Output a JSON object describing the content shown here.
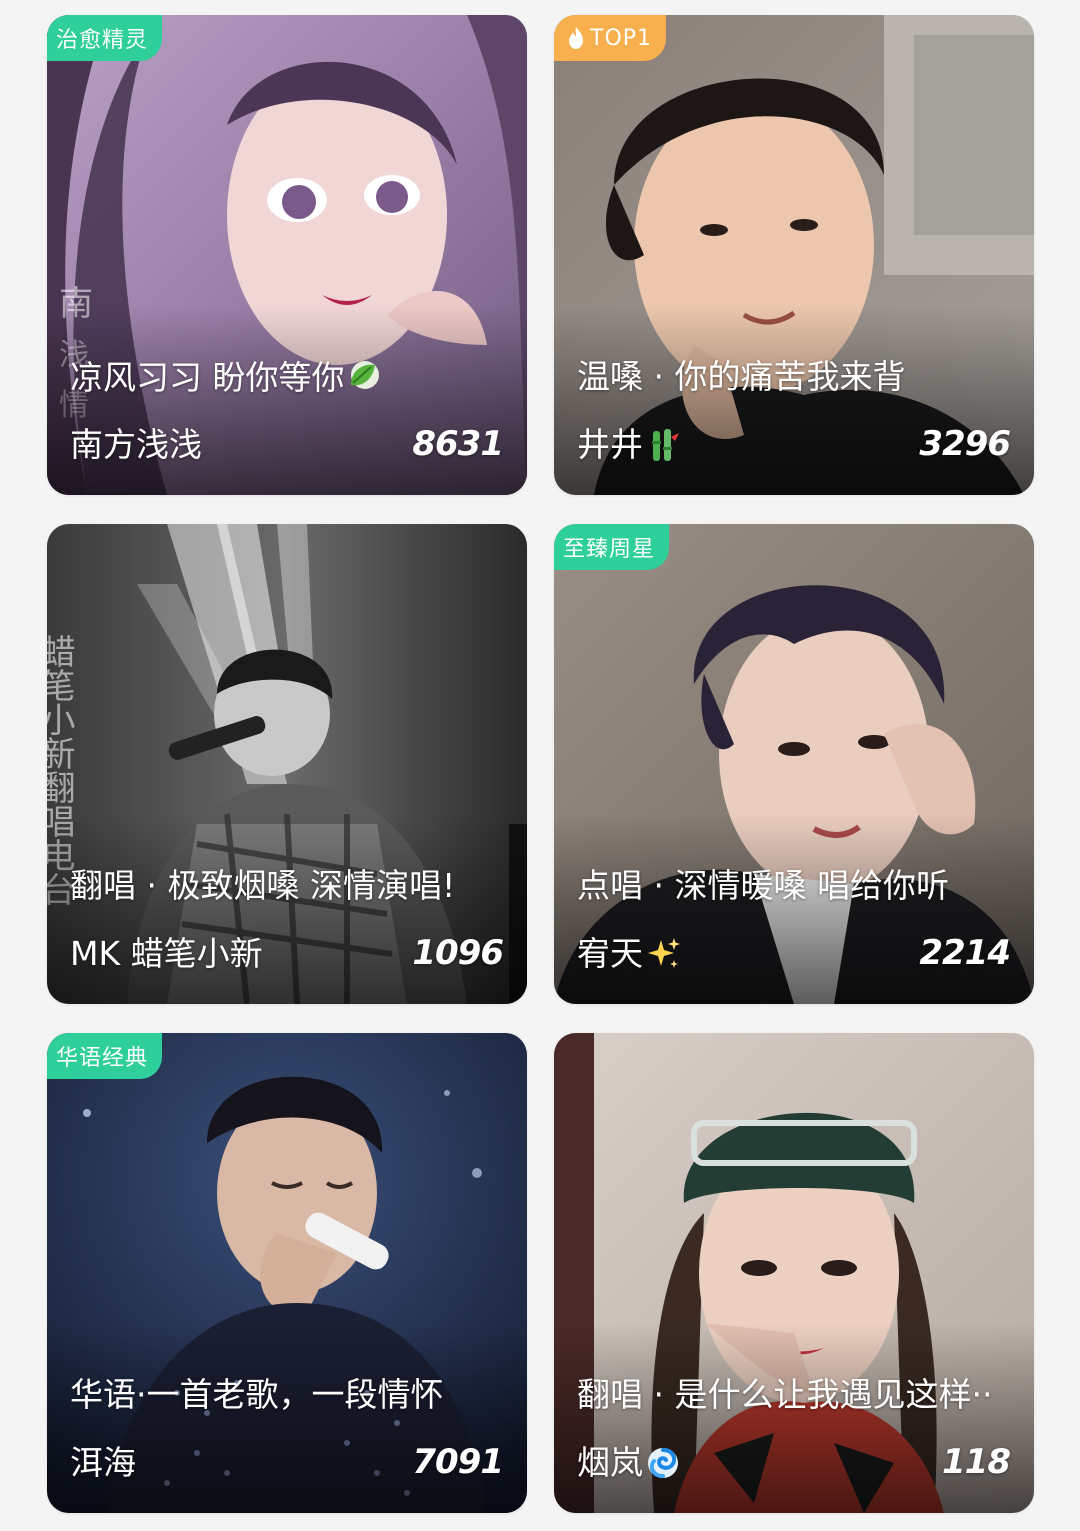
{
  "cards": [
    {
      "badge": "治愈精灵",
      "title": "凉风习习 盼你等你",
      "author": "南方浅浅",
      "count": "8631",
      "title_emoji": "leaf-icon",
      "photo_side_text": "南 浅 情"
    },
    {
      "badge": "TOP1",
      "badge_icon": "flame-icon",
      "title": "温嗓 · 你的痛苦我来背",
      "author": "井井",
      "author_emoji": "bamboo-icon",
      "count": "3296"
    },
    {
      "title": "翻唱 · 极致烟嗓 深情演唱!",
      "author": "MK 蜡笔小新",
      "count": "1096",
      "photo_side_text": "蜡笔小新翻唱电台"
    },
    {
      "badge": "至臻周星",
      "title": "点唱 · 深情暖嗓 唱给你听",
      "author": "宥天",
      "author_emoji": "sparkles-icon",
      "count": "2214"
    },
    {
      "badge": "华语经典",
      "title": "华语·一首老歌，一段情怀",
      "author": "洱海",
      "count": "7091"
    },
    {
      "title": "翻唱 · 是什么让我遇见这样··",
      "author": "烟岚",
      "author_emoji": "swirl-icon",
      "count": "118"
    }
  ],
  "colors": {
    "badge_green": "#2fcf9b",
    "badge_orange": "#f7b04d",
    "page_background": "#f4f4f4"
  }
}
